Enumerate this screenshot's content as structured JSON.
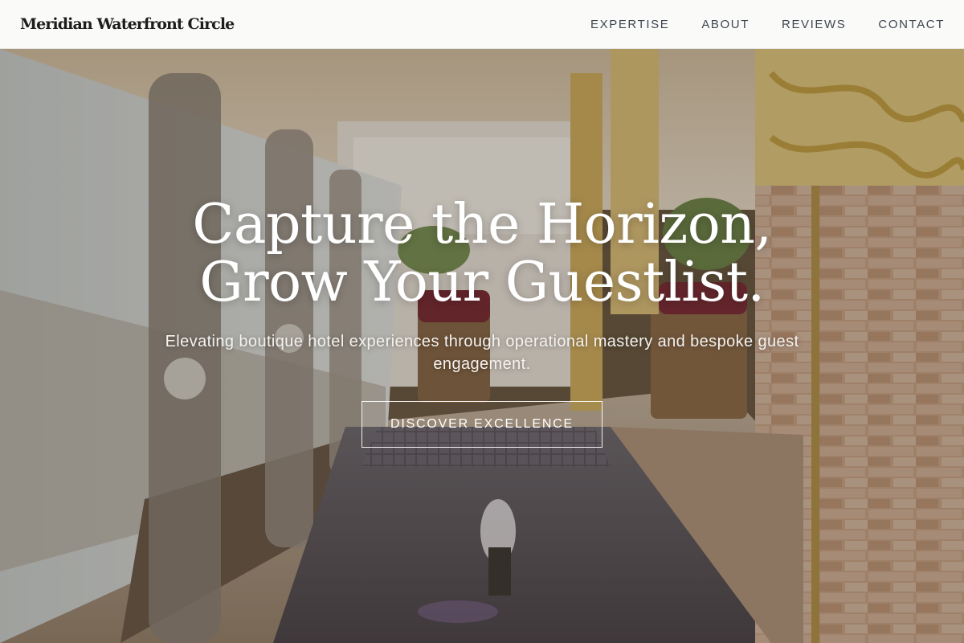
{
  "header": {
    "brand": "Meridian Waterfront Circle",
    "nav": [
      {
        "label": "EXPERTISE"
      },
      {
        "label": "ABOUT"
      },
      {
        "label": "REVIEWS"
      },
      {
        "label": "CONTACT"
      }
    ]
  },
  "hero": {
    "headline_line1": "Capture the Horizon,",
    "headline_line2": "Grow Your Guestlist.",
    "subheadline": "Elevating boutique hotel experiences through operational mastery and bespoke guest engagement.",
    "cta_label": "DISCOVER EXCELLENCE",
    "background_image": "hotel-lobby-fountain-photo"
  },
  "colors": {
    "header_bg": "#ffffff",
    "nav_text": "#3f4652",
    "brand_text": "#1d1d1d",
    "hero_text": "#ffffff"
  }
}
